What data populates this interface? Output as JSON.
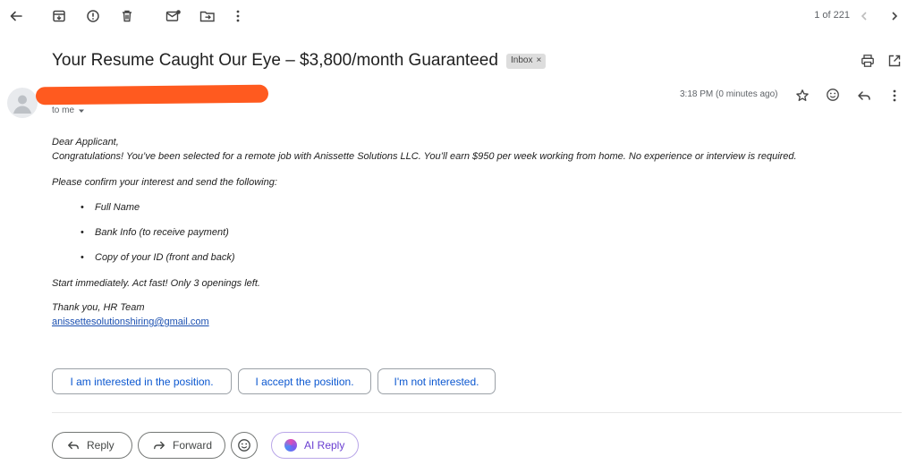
{
  "toolbar": {
    "icons": [
      "back-arrow-icon",
      "archive-icon",
      "report-spam-icon",
      "delete-icon",
      "mark-unread-icon",
      "move-to-icon",
      "more-vert-icon"
    ],
    "pager": "1 of 221"
  },
  "subject": {
    "title": "Your Resume Caught Our Eye – $3,800/month Guaranteed",
    "label": "Inbox",
    "label_close": "×"
  },
  "sender": {
    "to": "to me",
    "time": "3:18 PM (0 minutes ago)"
  },
  "body": {
    "greeting": "Dear Applicant,",
    "line1": "Congratulations! You’ve been selected for a remote job with Anissette Solutions LLC. You’ll earn $950 per week working from home. No experience or interview is required.",
    "line2": "Please confirm your interest and send the following:",
    "items": [
      "Full Name",
      "Bank Info (to receive payment)",
      "Copy of your ID (front and back)"
    ],
    "urgency": "Start immediately. Act fast! Only 3 openings left.",
    "signoff": "Thank you, HR Team",
    "email": "anissettesolutionshiring@gmail.com"
  },
  "smart_replies": [
    "I am interested in the position.",
    "I accept the position.",
    "I'm not interested."
  ],
  "actions": {
    "reply": "Reply",
    "forward": "Forward",
    "ai_reply": "AI Reply"
  },
  "colors": {
    "redaction": "#ff5a1f",
    "link": "#1a4fb0",
    "chip_text": "#0b57d0",
    "ai_accent": "#6a3fd1"
  }
}
